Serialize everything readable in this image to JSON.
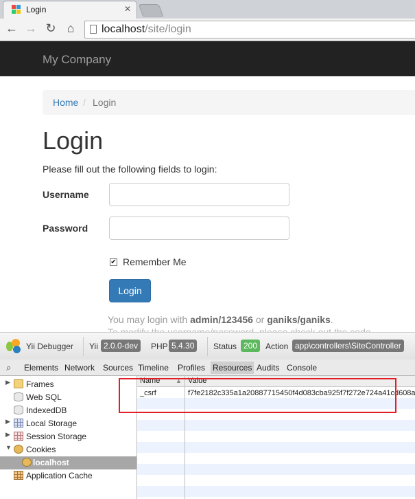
{
  "browser": {
    "tab_title": "Login",
    "tab_close": "✕",
    "url_host": "localhost",
    "url_path": "/site/login",
    "nav": {
      "back": "←",
      "forward": "→",
      "reload": "↻",
      "home": "⌂"
    }
  },
  "navbar": {
    "brand": "My Company"
  },
  "breadcrumb": {
    "home": "Home",
    "separator": "/",
    "active": "Login"
  },
  "page": {
    "title": "Login",
    "intro": "Please fill out the following fields to login:",
    "username_label": "Username",
    "username_value": "",
    "password_label": "Password",
    "password_value": "",
    "remember_label": "Remember Me",
    "remember_checked": "✔",
    "login_button": "Login",
    "hint": {
      "prefix": "You may login with ",
      "cred1": "admin/123456",
      "middle": " or ",
      "cred2": "ganiks/ganiks",
      "suffix": ".",
      "line2": "To modify the username/password, please check out the code"
    }
  },
  "debugbar": {
    "debugger_label": "Yii Debugger",
    "yii_label": "Yii",
    "yii_version": "2.0.0-dev",
    "php_label": "PHP",
    "php_version": "5.4.30",
    "status_label": "Status",
    "status_code": "200",
    "action_label": "Action",
    "action_value": "app\\controllers\\SiteController"
  },
  "devtools": {
    "search_icon": "⌕",
    "tabs": [
      "Elements",
      "Network",
      "Sources",
      "Timeline",
      "Profiles",
      "Resources",
      "Audits",
      "Console"
    ],
    "active_tab": "Resources",
    "tree": {
      "frames": "Frames",
      "web_sql": "Web SQL",
      "indexeddb": "IndexedDB",
      "local_storage": "Local Storage",
      "session_storage": "Session Storage",
      "cookies": "Cookies",
      "localhost": "localhost",
      "application_cache": "Application Cache",
      "arrow_collapsed": "▶",
      "arrow_expanded": "▼"
    },
    "table": {
      "col_name": "Name",
      "col_value": "Value",
      "sort_arrow": "▲",
      "rows": [
        {
          "name": "_csrf",
          "value": "f7fe2182c335a1a20887715450f4d083cba925f7f272e724a41cd608a"
        }
      ]
    }
  },
  "colors": {
    "navbar_bg": "#222222",
    "link": "#337ab7",
    "primary_button": "#337ab7",
    "status_green": "#5cb85c",
    "highlight_red": "#e21f26"
  }
}
